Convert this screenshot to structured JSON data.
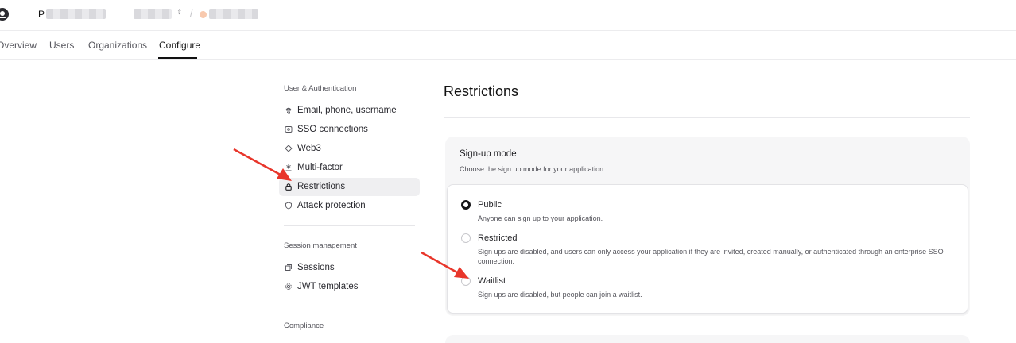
{
  "header": {
    "project_initial": "P",
    "chevron_glyph": "⌃⌄",
    "separator": "/"
  },
  "tabs": [
    {
      "label": "Overview"
    },
    {
      "label": "Users"
    },
    {
      "label": "Organizations"
    },
    {
      "label": "Configure",
      "active": true
    }
  ],
  "sidebar": {
    "sections": [
      {
        "heading": "User & Authentication",
        "items": [
          {
            "label": "Email, phone, username",
            "icon": "fingerprint-icon"
          },
          {
            "label": "SSO connections",
            "icon": "sso-icon"
          },
          {
            "label": "Web3",
            "icon": "diamond-icon"
          },
          {
            "label": "Multi-factor",
            "icon": "asterisk-icon"
          },
          {
            "label": "Restrictions",
            "icon": "lock-icon",
            "active": true
          },
          {
            "label": "Attack protection",
            "icon": "shield-icon"
          }
        ]
      },
      {
        "heading": "Session management",
        "items": [
          {
            "label": "Sessions",
            "icon": "sessions-icon"
          },
          {
            "label": "JWT templates",
            "icon": "gear-icon"
          }
        ]
      },
      {
        "heading": "Compliance",
        "items": []
      }
    ]
  },
  "main": {
    "title": "Restrictions",
    "signup": {
      "title": "Sign-up mode",
      "description": "Choose the sign up mode for your application.",
      "selected": "public",
      "options": [
        {
          "id": "public",
          "label": "Public",
          "description": "Anyone can sign up to your application."
        },
        {
          "id": "restricted",
          "label": "Restricted",
          "description": "Sign ups are disabled, and users can only access your application if they are invited, created manually, or authenticated through an enterprise SSO connection."
        },
        {
          "id": "waitlist",
          "label": "Waitlist",
          "description": "Sign ups are disabled, but people can join a waitlist."
        }
      ]
    }
  },
  "colors": {
    "accent": "#141416",
    "annotation_arrow": "#e8362b",
    "active_bg": "#efeff1",
    "card_bg": "#f6f6f7"
  }
}
